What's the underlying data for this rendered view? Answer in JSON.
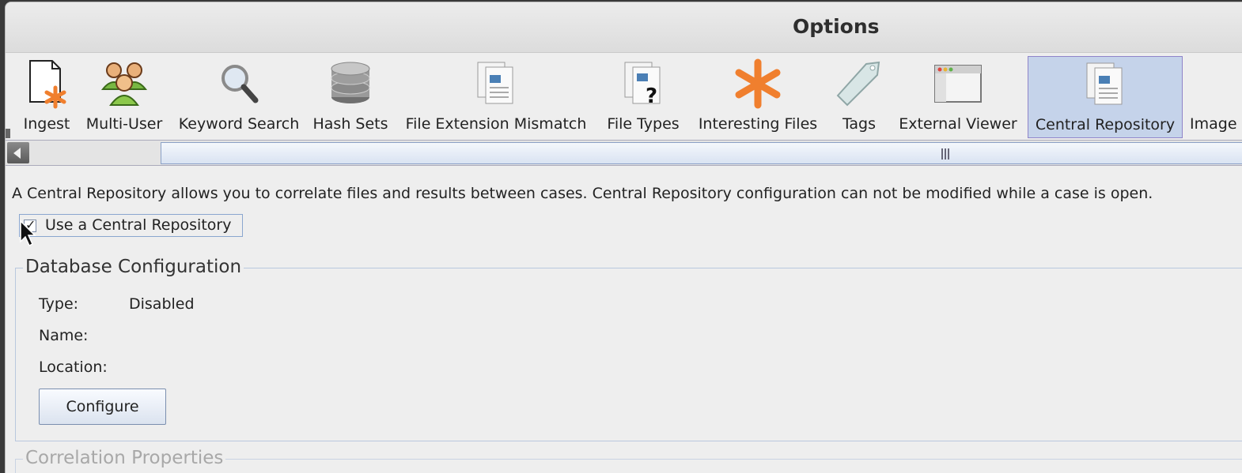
{
  "window": {
    "title": "Options"
  },
  "toolbar": {
    "items": [
      {
        "label": "Ingest",
        "icon": "ingest-icon"
      },
      {
        "label": "Multi-User",
        "icon": "users-icon"
      },
      {
        "label": "Keyword Search",
        "icon": "magnifier-icon"
      },
      {
        "label": "Hash Sets",
        "icon": "database-icon"
      },
      {
        "label": "File Extension Mismatch",
        "icon": "documents-icon"
      },
      {
        "label": "File Types",
        "icon": "documents-question-icon"
      },
      {
        "label": "Interesting Files",
        "icon": "asterisk-icon"
      },
      {
        "label": "Tags",
        "icon": "tag-icon"
      },
      {
        "label": "External Viewer",
        "icon": "window-icon"
      },
      {
        "label": "Central Repository",
        "icon": "documents-icon",
        "selected": true
      },
      {
        "label": "Image",
        "icon": "image-icon"
      }
    ]
  },
  "central_repo": {
    "description": "A Central Repository allows you to correlate files and results between cases. Central Repository configuration can not be modified while a case is open.",
    "use_checkbox_label": "Use a Central Repository",
    "use_checked": true,
    "db_config": {
      "title": "Database Configuration",
      "type_label": "Type:",
      "type_value": "Disabled",
      "name_label": "Name:",
      "name_value": "",
      "location_label": "Location:",
      "location_value": "",
      "configure_button": "Configure"
    },
    "correlation": {
      "title": "Correlation Properties"
    }
  },
  "colors": {
    "selected_bg": "#c5d3ea",
    "accent_orange": "#f07f2e"
  }
}
